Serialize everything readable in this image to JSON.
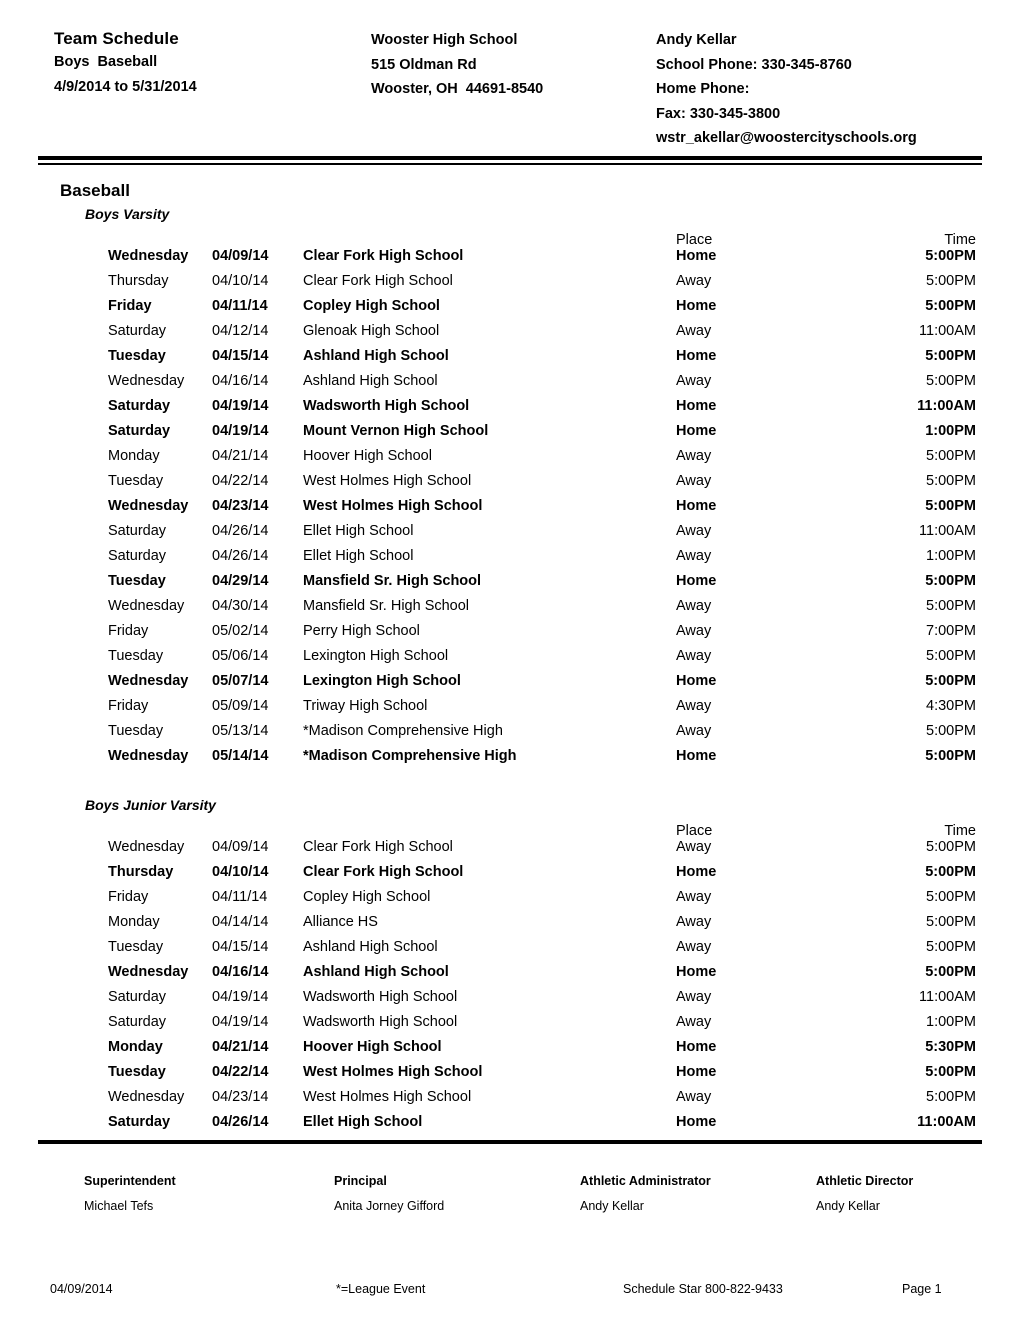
{
  "header": {
    "title": "Team Schedule",
    "sport_line": "Boys  Baseball",
    "date_range": "4/9/2014 to 5/31/2014",
    "school_name": "Wooster High School",
    "school_address": "515 Oldman Rd",
    "school_city_state_zip": "Wooster, OH  44691-8540",
    "contact_name": "Andy Kellar",
    "school_phone": "School Phone: 330-345-8760",
    "home_phone": "Home Phone:",
    "fax": "Fax: 330-345-3800",
    "email": "wstr_akellar@woostercityschools.org"
  },
  "sport": {
    "name": "Baseball"
  },
  "columns": {
    "place": "Place",
    "time": "Time"
  },
  "groups": [
    {
      "name": "Boys Varsity",
      "rows": [
        {
          "day": "Wednesday",
          "date": "04/09/14",
          "opponent": "Clear Fork High School",
          "place": "Home",
          "time": "5:00PM"
        },
        {
          "day": "Thursday",
          "date": "04/10/14",
          "opponent": "Clear Fork High School",
          "place": "Away",
          "time": "5:00PM"
        },
        {
          "day": "Friday",
          "date": "04/11/14",
          "opponent": "Copley High School",
          "place": "Home",
          "time": "5:00PM"
        },
        {
          "day": "Saturday",
          "date": "04/12/14",
          "opponent": "Glenoak High School",
          "place": "Away",
          "time": "11:00AM"
        },
        {
          "day": "Tuesday",
          "date": "04/15/14",
          "opponent": "Ashland High School",
          "place": "Home",
          "time": "5:00PM"
        },
        {
          "day": "Wednesday",
          "date": "04/16/14",
          "opponent": "Ashland High School",
          "place": "Away",
          "time": "5:00PM"
        },
        {
          "day": "Saturday",
          "date": "04/19/14",
          "opponent": "Wadsworth High School",
          "place": "Home",
          "time": "11:00AM"
        },
        {
          "day": "Saturday",
          "date": "04/19/14",
          "opponent": "Mount Vernon High School",
          "place": "Home",
          "time": "1:00PM"
        },
        {
          "day": "Monday",
          "date": "04/21/14",
          "opponent": "Hoover High School",
          "place": "Away",
          "time": "5:00PM"
        },
        {
          "day": "Tuesday",
          "date": "04/22/14",
          "opponent": "West Holmes High School",
          "place": "Away",
          "time": "5:00PM"
        },
        {
          "day": "Wednesday",
          "date": "04/23/14",
          "opponent": "West Holmes High School",
          "place": "Home",
          "time": "5:00PM"
        },
        {
          "day": "Saturday",
          "date": "04/26/14",
          "opponent": "Ellet High School",
          "place": "Away",
          "time": "11:00AM"
        },
        {
          "day": "Saturday",
          "date": "04/26/14",
          "opponent": "Ellet High School",
          "place": "Away",
          "time": "1:00PM"
        },
        {
          "day": "Tuesday",
          "date": "04/29/14",
          "opponent": "Mansfield Sr. High School",
          "place": "Home",
          "time": "5:00PM"
        },
        {
          "day": "Wednesday",
          "date": "04/30/14",
          "opponent": "Mansfield Sr. High School",
          "place": "Away",
          "time": "5:00PM"
        },
        {
          "day": "Friday",
          "date": "05/02/14",
          "opponent": "Perry High School",
          "place": "Away",
          "time": "7:00PM"
        },
        {
          "day": "Tuesday",
          "date": "05/06/14",
          "opponent": "Lexington High School",
          "place": "Away",
          "time": "5:00PM"
        },
        {
          "day": "Wednesday",
          "date": "05/07/14",
          "opponent": "Lexington High School",
          "place": "Home",
          "time": "5:00PM"
        },
        {
          "day": "Friday",
          "date": "05/09/14",
          "opponent": "Triway High School",
          "place": "Away",
          "time": "4:30PM"
        },
        {
          "day": "Tuesday",
          "date": "05/13/14",
          "opponent": "*Madison Comprehensive High",
          "place": "Away",
          "time": "5:00PM"
        },
        {
          "day": "Wednesday",
          "date": "05/14/14",
          "opponent": "*Madison Comprehensive High",
          "place": "Home",
          "time": "5:00PM"
        }
      ]
    },
    {
      "name": "Boys Junior Varsity",
      "rows": [
        {
          "day": "Wednesday",
          "date": "04/09/14",
          "opponent": "Clear Fork High School",
          "place": "Away",
          "time": "5:00PM"
        },
        {
          "day": "Thursday",
          "date": "04/10/14",
          "opponent": "Clear Fork High School",
          "place": "Home",
          "time": "5:00PM"
        },
        {
          "day": "Friday",
          "date": "04/11/14",
          "opponent": "Copley High School",
          "place": "Away",
          "time": "5:00PM"
        },
        {
          "day": "Monday",
          "date": "04/14/14",
          "opponent": "Alliance HS",
          "place": "Away",
          "time": "5:00PM"
        },
        {
          "day": "Tuesday",
          "date": "04/15/14",
          "opponent": "Ashland High School",
          "place": "Away",
          "time": "5:00PM"
        },
        {
          "day": "Wednesday",
          "date": "04/16/14",
          "opponent": "Ashland High School",
          "place": "Home",
          "time": "5:00PM"
        },
        {
          "day": "Saturday",
          "date": "04/19/14",
          "opponent": "Wadsworth High School",
          "place": "Away",
          "time": "11:00AM"
        },
        {
          "day": "Saturday",
          "date": "04/19/14",
          "opponent": "Wadsworth High School",
          "place": "Away",
          "time": "1:00PM"
        },
        {
          "day": "Monday",
          "date": "04/21/14",
          "opponent": "Hoover High School",
          "place": "Home",
          "time": "5:30PM"
        },
        {
          "day": "Tuesday",
          "date": "04/22/14",
          "opponent": "West Holmes High School",
          "place": "Home",
          "time": "5:00PM"
        },
        {
          "day": "Wednesday",
          "date": "04/23/14",
          "opponent": "West Holmes High School",
          "place": "Away",
          "time": "5:00PM"
        },
        {
          "day": "Saturday",
          "date": "04/26/14",
          "opponent": "Ellet High School",
          "place": "Home",
          "time": "11:00AM"
        }
      ]
    }
  ],
  "signatures": [
    {
      "title": "Superintendent",
      "name": "Michael Tefs"
    },
    {
      "title": "Principal",
      "name": "Anita Jorney Gifford"
    },
    {
      "title": "Athletic Administrator",
      "name": "Andy Kellar"
    },
    {
      "title": "Athletic Director",
      "name": "Andy Kellar"
    }
  ],
  "footer": {
    "date": "04/09/2014",
    "legend": "*=League Event",
    "vendor": "Schedule Star 800-822-9433",
    "page": "Page 1"
  }
}
